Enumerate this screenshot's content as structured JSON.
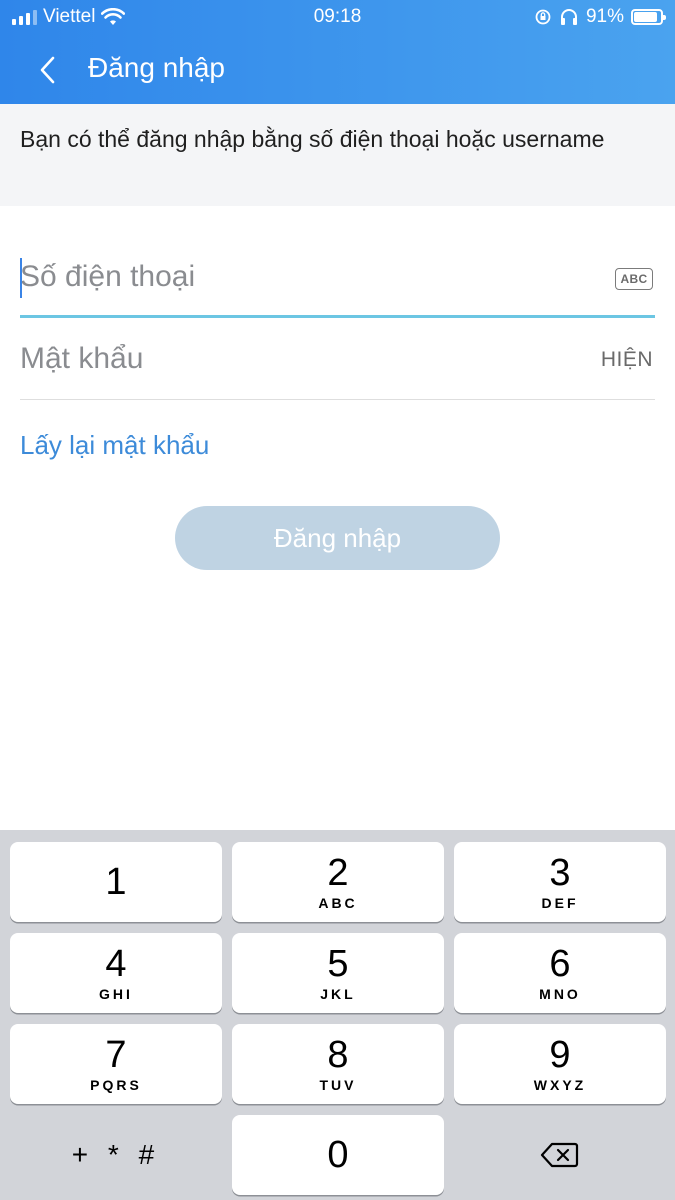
{
  "status_bar": {
    "carrier": "Viettel",
    "time": "09:18",
    "battery_text": "91%",
    "battery_level": 0.91
  },
  "nav": {
    "title": "Đăng nhập",
    "back_icon": "chevron-left-icon"
  },
  "info": {
    "text": "Bạn có thể đăng nhập bằng số điện thoại hoặc username"
  },
  "form": {
    "phone_placeholder": "Số điện thoại",
    "keyboard_badge": "ABC",
    "password_placeholder": "Mật khẩu",
    "show_label": "HIỆN",
    "forgot_label": "Lấy lại mật khẩu",
    "login_label": "Đăng nhập"
  },
  "keypad": {
    "keys": [
      {
        "digit": "1",
        "letters": ""
      },
      {
        "digit": "2",
        "letters": "ABC"
      },
      {
        "digit": "3",
        "letters": "DEF"
      },
      {
        "digit": "4",
        "letters": "GHI"
      },
      {
        "digit": "5",
        "letters": "JKL"
      },
      {
        "digit": "6",
        "letters": "MNO"
      },
      {
        "digit": "7",
        "letters": "PQRS"
      },
      {
        "digit": "8",
        "letters": "TUV"
      },
      {
        "digit": "9",
        "letters": "WXYZ"
      }
    ],
    "symbols": "+ * #",
    "zero": "0",
    "delete_icon": "backspace-icon"
  },
  "colors": {
    "header_start": "#2f86ea",
    "header_end": "#4aa3ef",
    "link": "#3d8bd9",
    "focus_underline": "#6cc6e3",
    "button_disabled": "#bfd3e3",
    "keypad_bg": "#d2d4d9"
  }
}
